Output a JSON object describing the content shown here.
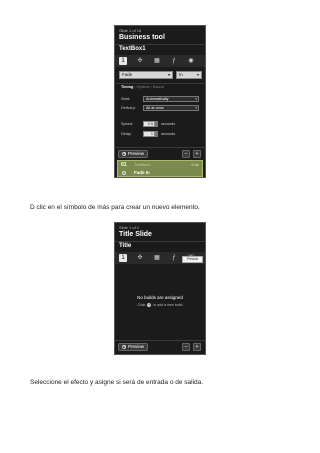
{
  "panel1": {
    "slide_count": "Slide 1 of 16",
    "title": "Business tool",
    "object": "TextBox1",
    "tools": [
      {
        "icon": "number-one-icon",
        "glyph": "1"
      },
      {
        "icon": "move-arrows-icon",
        "glyph": "✣"
      },
      {
        "icon": "grid-layout-icon",
        "glyph": "▦"
      },
      {
        "icon": "function-icon",
        "glyph": "ƒ"
      },
      {
        "icon": "eye-icon",
        "glyph": "◉"
      }
    ],
    "effect": "Fade",
    "direction": "In",
    "tabs": {
      "timing": "Timing",
      "options": "Options",
      "sound": "Sound"
    },
    "start_label": "Start:",
    "start_value": "Automatically",
    "delivery_label": "Delivery:",
    "delivery_value": "All at once",
    "speed_label": "Speed:",
    "speed_value": "0.5",
    "speed_unit": "seconds",
    "delay_label": "Delay:",
    "delay_value": "1",
    "delay_unit": "seconds",
    "preview_label": "Preview",
    "build": {
      "number": "01",
      "object": "TextBox1",
      "time": "0.5s",
      "effect": "Fade In"
    }
  },
  "caption1": "D clic en el símbolo de más para crear un nuevo elemento.",
  "panel2": {
    "slide_count": "Slide 1 of 1",
    "title": "Title Slide",
    "object": "Title",
    "tools": [
      {
        "icon": "number-one-icon",
        "glyph": "1"
      },
      {
        "icon": "move-arrows-icon",
        "glyph": "✣"
      },
      {
        "icon": "grid-layout-icon",
        "glyph": "▦"
      },
      {
        "icon": "function-icon",
        "glyph": "ƒ"
      },
      {
        "icon": "eye-icon",
        "glyph": "◉"
      }
    ],
    "tooltip": "Preview",
    "empty_title": "No builds are assigned",
    "empty_hint_before": "Click",
    "empty_hint_after": "to add a new build",
    "preview_label": "Preview"
  },
  "caption2": "Seleccione el efecto y asigne si será de entrada o de salida."
}
